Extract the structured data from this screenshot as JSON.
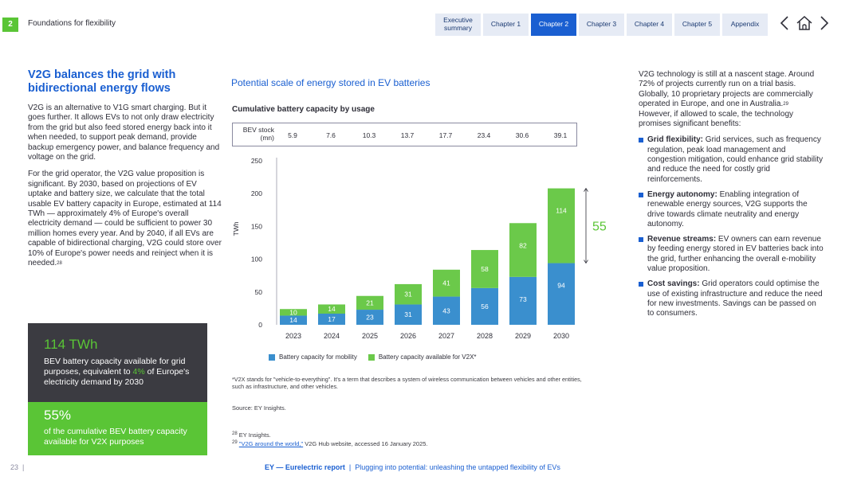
{
  "header": {
    "section_number": "2",
    "section_title": "Foundations for flexibility",
    "tabs": [
      {
        "label": "Executive summary",
        "active": false
      },
      {
        "label": "Chapter 1",
        "active": false
      },
      {
        "label": "Chapter 2",
        "active": true
      },
      {
        "label": "Chapter 3",
        "active": false
      },
      {
        "label": "Chapter 4",
        "active": false
      },
      {
        "label": "Chapter 5",
        "active": false
      },
      {
        "label": "Appendix",
        "active": false
      }
    ],
    "icons": [
      "chevron-left-icon",
      "home-icon",
      "chevron-right-icon"
    ]
  },
  "left": {
    "heading": "V2G balances the grid with bidirectional energy flows",
    "para1": "V2G is an alternative to V1G smart charging. But it goes further. It allows EVs to not only draw electricity from the grid but also feed stored energy back into it when needed, to support peak demand, provide backup emergency power, and balance frequency and voltage on the grid.",
    "para2": "For the grid operator, the V2G value proposition is significant. By 2030, based on projections of EV uptake and battery size, we calculate that the total usable EV battery capacity in Europe, estimated at 114 TWh — approximately 4% of Europe's overall electricity demand — could be sufficient to power 30 million homes every year. And by 2040, if all EVs are capable of bidirectional charging, V2G could store over 10% of Europe's power needs and reinject when it is needed.",
    "para2_sup": "28",
    "stat1": {
      "value": "114 TWh",
      "text_a": "BEV battery capacity available for grid purposes, equivalent to ",
      "text_hl": "4%",
      "text_b": " of Europe's electricity demand by 2030"
    },
    "stat2": {
      "value": "55%",
      "text": "of the cumulative BEV battery capacity available for V2X purposes"
    }
  },
  "chart": {
    "title": "Potential scale of energy stored in EV batteries",
    "subtitle": "Cumulative battery capacity by usage",
    "stock_label": "BEV stock (mn)",
    "stock_values": [
      "5.9",
      "7.6",
      "10.3",
      "13.7",
      "17.7",
      "23.4",
      "30.6",
      "39.1"
    ],
    "percent_callout": "55%",
    "note": "*V2X stands for \"vehicle-to-everything\". It's a term that describes a system of wireless communication between vehicles and other entities, such as infrastructure, and other vehicles.",
    "source": "Source: EY Insights.",
    "fn28": "EY Insights.",
    "fn29_link": "\"V2G around the world,\"",
    "fn29_rest": " V2G Hub website, accessed 16 January 2025.",
    "fn28_num": "28",
    "fn29_num": "29"
  },
  "chart_data": {
    "type": "bar",
    "stacked": true,
    "categories": [
      "2023",
      "2024",
      "2025",
      "2026",
      "2027",
      "2028",
      "2029",
      "2030"
    ],
    "series": [
      {
        "name": "Battery capacity for mobility",
        "color": "#3a8fce",
        "values": [
          14,
          17,
          23,
          31,
          43,
          56,
          73,
          94
        ]
      },
      {
        "name": "Battery capacity available for V2X*",
        "color": "#6bc94a",
        "values": [
          10,
          14,
          21,
          31,
          41,
          58,
          82,
          114
        ]
      }
    ],
    "ylabel": "TWh",
    "ylim": [
      0,
      250
    ],
    "yticks": [
      0,
      50,
      100,
      150,
      200,
      250
    ],
    "grid": false,
    "legend": "bottom"
  },
  "right": {
    "intro": "V2G technology is still at a nascent stage. Around 72% of projects currently run on a trial basis. Globally, 10 proprietary projects are commercially operated in Europe, and one in Australia. However, if allowed to scale, the technology promises significant benefits:",
    "intro_a": "V2G technology is still at a nascent stage. Around 72% of projects currently run on a trial basis. Globally, 10 proprietary projects are commercially operated in Europe, and one in Australia.",
    "intro_sup": "29",
    "intro_b": " However, if allowed to scale, the technology promises significant benefits:",
    "bullets": [
      {
        "title": "Grid flexibility:",
        "text": " Grid services, such as frequency regulation, peak load management and congestion mitigation, could enhance grid stability and reduce the need for costly grid reinforcements."
      },
      {
        "title": "Energy autonomy:",
        "text": " Enabling integration of renewable energy sources, V2G supports the drive towards climate neutrality and energy autonomy."
      },
      {
        "title": "Revenue streams:",
        "text": " EV owners can earn revenue by feeding energy stored in EV batteries back into the grid, further enhancing the overall e-mobility value proposition."
      },
      {
        "title": "Cost savings:",
        "text": " Grid operators could optimise the use of existing infrastructure and reduce the need for new investments. Savings can be passed on to consumers."
      }
    ]
  },
  "footer": {
    "page_number": "23",
    "bold": "EY — Eurelectric report",
    "rest": "Plugging into potential: unleashing the untapped flexibility of EVs"
  }
}
